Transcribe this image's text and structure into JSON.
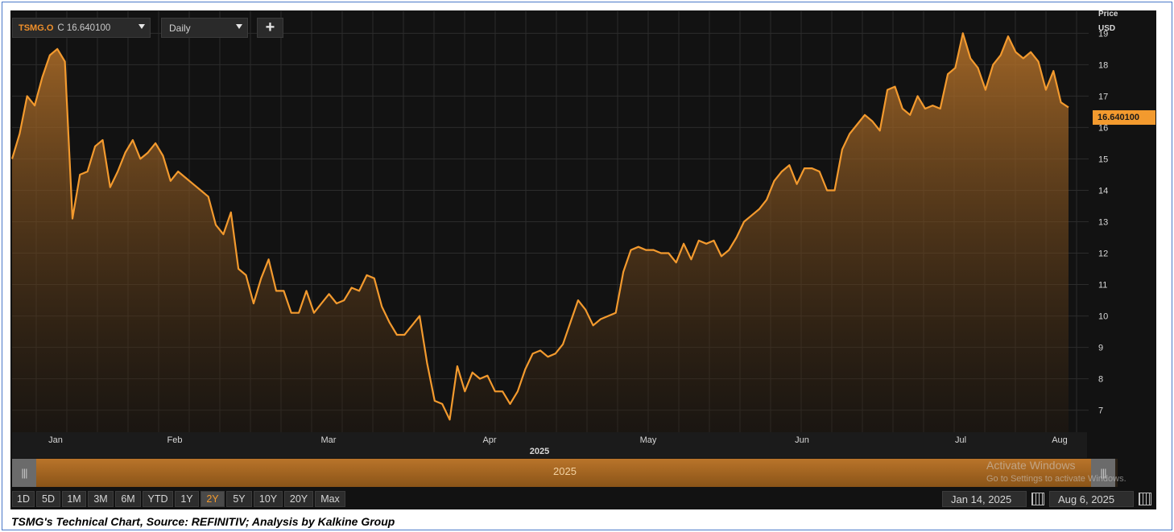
{
  "toolbar": {
    "symbol": "TSMG.O",
    "close_text": "C 16.640100",
    "interval": "Daily",
    "add_label": "+"
  },
  "price_axis": {
    "label": "Price",
    "unit": "USD",
    "last_value": "16.640100"
  },
  "navigator": {
    "year_label": "2025"
  },
  "watermark": {
    "line1": "Activate Windows",
    "line2": "Go to Settings to activate Windows."
  },
  "range_buttons": [
    "1D",
    "5D",
    "1M",
    "3M",
    "6M",
    "YTD",
    "1Y",
    "2Y",
    "5Y",
    "10Y",
    "20Y",
    "Max"
  ],
  "active_range": "2Y",
  "dates": {
    "start": "Jan 14, 2025",
    "end": "Aug 6, 2025"
  },
  "caption": "TSMG's Technical Chart, Source: REFINITIV; Analysis by Kalkine Group",
  "colors": {
    "line": "#f39a2e",
    "background": "#121212",
    "grid": "#2c2c2c"
  },
  "chart_data": {
    "type": "area",
    "ylim": [
      6.3,
      19.7
    ],
    "yticks": [
      7,
      8,
      9,
      10,
      11,
      12,
      13,
      14,
      15,
      16,
      17,
      18,
      19
    ],
    "x_labels": [
      "Jan",
      "Feb",
      "Mar",
      "Apr",
      "May",
      "Jun",
      "Jul",
      "Aug"
    ],
    "year_label": "2025",
    "grid": true,
    "series": [
      {
        "values": [
          15.0,
          15.8,
          17.0,
          16.7,
          17.6,
          18.3,
          18.5,
          18.1,
          13.1,
          14.5,
          14.6,
          15.4,
          15.6,
          14.1,
          14.6,
          15.2,
          15.6,
          15.0,
          15.2,
          15.5,
          15.1,
          14.3,
          14.6,
          14.4,
          14.2,
          14.0,
          13.8,
          12.9,
          12.6,
          13.3,
          11.5,
          11.3,
          10.4,
          11.2,
          11.8,
          10.8,
          10.8,
          10.1,
          10.1,
          10.8,
          10.1,
          10.4,
          10.7,
          10.4,
          10.5,
          10.9,
          10.8,
          11.3,
          11.2,
          10.3,
          9.8,
          9.4,
          9.4,
          9.7,
          10.0,
          8.5,
          7.3,
          7.2,
          6.7,
          8.4,
          7.6,
          8.2,
          8.0,
          8.1,
          7.6,
          7.6,
          7.2,
          7.6,
          8.3,
          8.8,
          8.9,
          8.7,
          8.8,
          9.1,
          9.8,
          10.5,
          10.2,
          9.7,
          9.9,
          10.0,
          10.1,
          11.4,
          12.1,
          12.2,
          12.1,
          12.1,
          12.0,
          12.0,
          11.7,
          12.3,
          11.8,
          12.4,
          12.3,
          12.4,
          11.9,
          12.1,
          12.5,
          13.0,
          13.2,
          13.4,
          13.7,
          14.3,
          14.6,
          14.8,
          14.2,
          14.7,
          14.7,
          14.6,
          14.0,
          14.0,
          15.3,
          15.8,
          16.1,
          16.4,
          16.2,
          15.9,
          17.2,
          17.3,
          16.6,
          16.4,
          17.0,
          16.6,
          16.7,
          16.6,
          17.7,
          17.9,
          19.0,
          18.2,
          17.9,
          17.2,
          18.0,
          18.3,
          18.9,
          18.4,
          18.2,
          18.4,
          18.1,
          17.2,
          17.8,
          16.8,
          16.64
        ]
      }
    ]
  }
}
